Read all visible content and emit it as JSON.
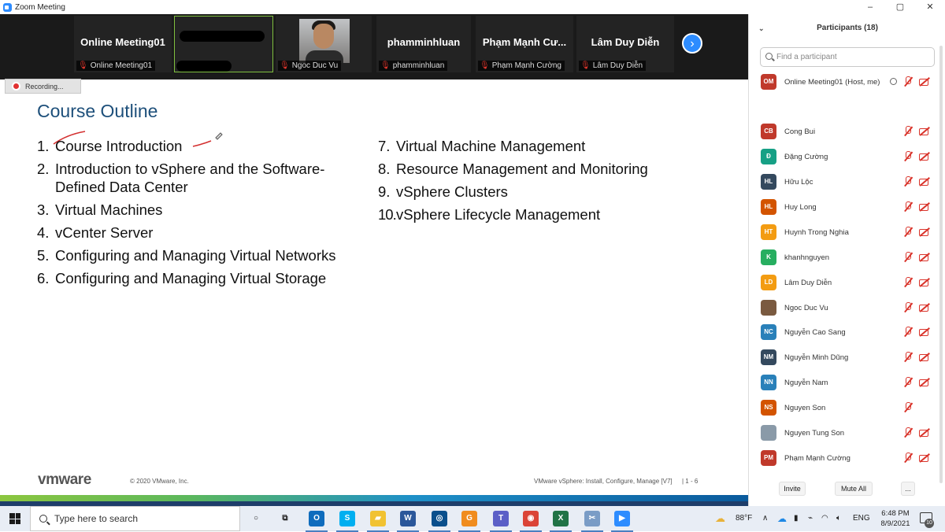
{
  "window": {
    "title": "Zoom Meeting",
    "controls": [
      "–",
      "▢",
      "✕"
    ]
  },
  "strip": {
    "tiles": [
      {
        "name": "Online Meeting01",
        "label": "Online Meeting01"
      },
      {
        "name": "",
        "label": ""
      },
      {
        "name": "",
        "label": "Ngoc Duc Vu"
      },
      {
        "name": "phamminhluan",
        "label": "phamminhluan"
      },
      {
        "name": "Phạm Mạnh Cư...",
        "label": "Phạm Mạnh Cường"
      },
      {
        "name": "Lâm Duy Diễn",
        "label": "Lâm Duy Diễn"
      }
    ],
    "next_icon": "›"
  },
  "recording": {
    "label": "Recording..."
  },
  "slide": {
    "title": "Course Outline",
    "left_items": [
      {
        "num": "1.",
        "text": "Course Introduction"
      },
      {
        "num": "2.",
        "text": "Introduction to vSphere and the Software-Defined Data Center"
      },
      {
        "num": "3.",
        "text": "Virtual Machines"
      },
      {
        "num": "4.",
        "text": "vCenter Server"
      },
      {
        "num": "5.",
        "text": "Configuring and Managing Virtual Networks"
      },
      {
        "num": "6.",
        "text": "Configuring and Managing Virtual Storage"
      }
    ],
    "right_items": [
      {
        "num": "7.",
        "text": "Virtual Machine Management"
      },
      {
        "num": "8.",
        "text": "Resource Management and Monitoring"
      },
      {
        "num": "9.",
        "text": "vSphere Clusters"
      },
      {
        "num": "10.",
        "text": "vSphere Lifecycle Management"
      }
    ],
    "footer_logo": "vmware",
    "footer_copyright": "© 2020 VMware, Inc.",
    "footer_course": "VMware vSphere: Install, Configure, Manage [V7]",
    "footer_page": "|     1 - 6"
  },
  "participants": {
    "header": "Participants (18)",
    "search_placeholder": "Find a participant",
    "list": [
      {
        "initials": "OM",
        "name": "Online Meeting01 (Host, me)",
        "color": "#c0392b",
        "share": true,
        "mic_muted": true,
        "cam_off": true
      },
      {
        "initials": "CB",
        "name": "Cong Bui",
        "color": "#c0392b",
        "mic_muted": true,
        "cam_off": true
      },
      {
        "initials": "Đ",
        "name": "Đặng Cường",
        "color": "#16a085",
        "mic_muted": true,
        "cam_off": true
      },
      {
        "initials": "HL",
        "name": "Hữu Lộc",
        "color": "#34495e",
        "mic_muted": true,
        "cam_off": true
      },
      {
        "initials": "HL",
        "name": "Huy Long",
        "color": "#d35400",
        "mic_muted": true,
        "cam_off": true
      },
      {
        "initials": "HT",
        "name": "Huynh Trong Nghia",
        "color": "#f39c12",
        "mic_muted": true,
        "cam_off": true
      },
      {
        "initials": "K",
        "name": "khanhnguyen",
        "color": "#27ae60",
        "mic_muted": true,
        "cam_off": true
      },
      {
        "initials": "LD",
        "name": "Lâm Duy Diễn",
        "color": "#f39c12",
        "mic_muted": true,
        "cam_off": true
      },
      {
        "initials": "",
        "name": "Ngoc Duc Vu",
        "color": "#7a5a40",
        "mic_muted": true,
        "cam_off": true
      },
      {
        "initials": "NC",
        "name": "Nguyễn Cao Sang",
        "color": "#2980b9",
        "mic_muted": true,
        "cam_off": true
      },
      {
        "initials": "NM",
        "name": "Nguyễn Minh Dũng",
        "color": "#34495e",
        "mic_muted": true,
        "cam_off": true
      },
      {
        "initials": "NN",
        "name": "Nguyễn Nam",
        "color": "#2980b9",
        "mic_muted": true,
        "cam_off": true
      },
      {
        "initials": "NS",
        "name": "Nguyen Son",
        "color": "#d35400",
        "mic_muted": true,
        "cam_off": false
      },
      {
        "initials": "",
        "name": "Nguyen Tung Son",
        "color": "#8a9aa8",
        "mic_muted": true,
        "cam_off": true
      },
      {
        "initials": "PM",
        "name": "Phạm Mạnh Cường",
        "color": "#c0392b",
        "mic_muted": true,
        "cam_off": true
      }
    ],
    "buttons": {
      "invite": "Invite",
      "mute_all": "Mute All",
      "more": "..."
    }
  },
  "taskbar": {
    "search_placeholder": "Type here to search",
    "apps": [
      {
        "name": "cortana",
        "glyph": "○",
        "color": "transparent"
      },
      {
        "name": "task-view",
        "glyph": "⧉",
        "color": "transparent"
      },
      {
        "name": "outlook",
        "glyph": "O",
        "color": "#0f6cbd"
      },
      {
        "name": "skype",
        "glyph": "S",
        "color": "#00aff0"
      },
      {
        "name": "file-explorer",
        "glyph": "▰",
        "color": "#f1c232"
      },
      {
        "name": "word",
        "glyph": "W",
        "color": "#2b579a"
      },
      {
        "name": "app-blue",
        "glyph": "◎",
        "color": "#0a4f8c"
      },
      {
        "name": "app-orange",
        "glyph": "G",
        "color": "#f08c1e"
      },
      {
        "name": "teams",
        "glyph": "T",
        "color": "#5b5fc7"
      },
      {
        "name": "chrome",
        "glyph": "◉",
        "color": "#db4437"
      },
      {
        "name": "excel",
        "glyph": "X",
        "color": "#217346"
      },
      {
        "name": "snipping",
        "glyph": "✂",
        "color": "#7a9cc6"
      },
      {
        "name": "zoom",
        "glyph": "▶",
        "color": "#2d8cff"
      }
    ],
    "weather": "88°F",
    "language": "ENG",
    "time": "6:48 PM",
    "date": "8/9/2021",
    "notifications": "10"
  }
}
